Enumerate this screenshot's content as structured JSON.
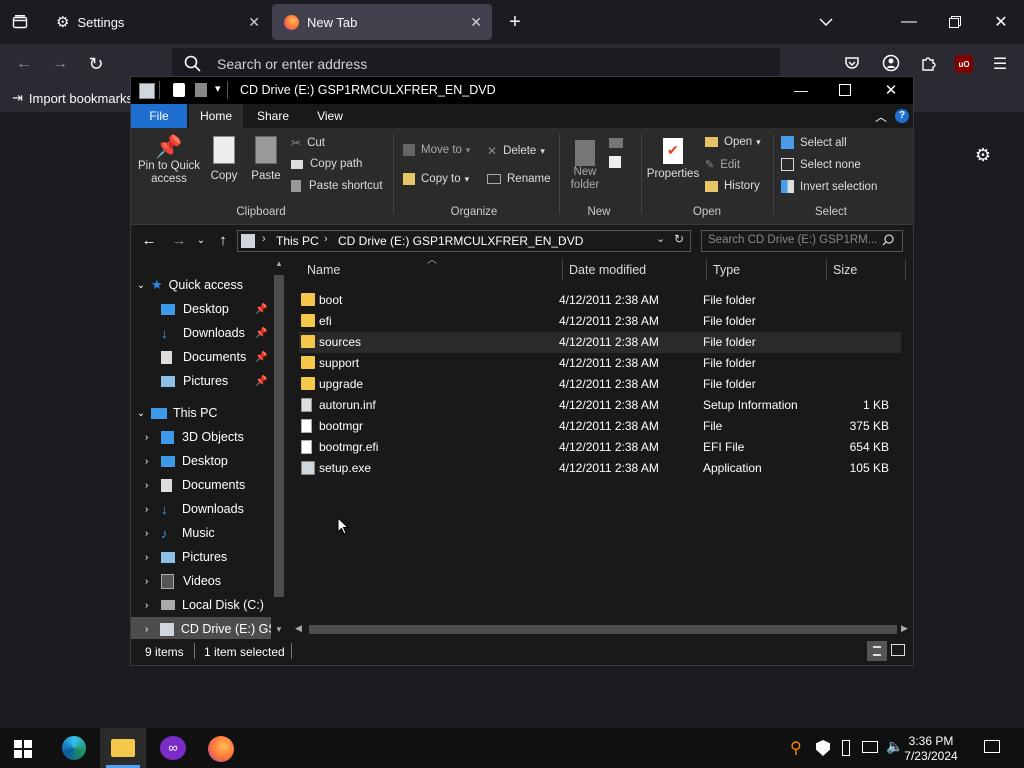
{
  "browser": {
    "tabs": [
      {
        "label": "Settings",
        "icon": "gear-icon"
      },
      {
        "label": "New Tab",
        "icon": "firefox-icon"
      }
    ],
    "address_placeholder": "Search or enter address",
    "bookmark": "Import bookmarks…"
  },
  "explorer": {
    "title": "CD Drive (E:) GSP1RMCULXFRER_EN_DVD",
    "ribbon_tabs": [
      "File",
      "Home",
      "Share",
      "View"
    ],
    "clipboard": {
      "pin": "Pin to Quick access",
      "copy": "Copy",
      "paste": "Paste",
      "cut": "Cut",
      "copy_path": "Copy path",
      "paste_shortcut": "Paste shortcut",
      "group": "Clipboard"
    },
    "organize": {
      "move_to": "Move to",
      "copy_to": "Copy to",
      "delete": "Delete",
      "rename": "Rename",
      "group": "Organize"
    },
    "new": {
      "new_folder": "New folder",
      "group": "New"
    },
    "open": {
      "properties": "Properties",
      "open": "Open",
      "edit": "Edit",
      "history": "History",
      "group": "Open"
    },
    "select": {
      "select_all": "Select all",
      "select_none": "Select none",
      "invert": "Invert selection",
      "group": "Select"
    },
    "address": {
      "this_pc": "This PC",
      "drive": "CD Drive (E:) GSP1RMCULXFRER_EN_DVD"
    },
    "search_placeholder": "Search CD Drive (E:) GSP1RM...",
    "nav": {
      "quick_access": "Quick access",
      "quick_items": [
        "Desktop",
        "Downloads",
        "Documents",
        "Pictures"
      ],
      "this_pc": "This PC",
      "pc_items": [
        "3D Objects",
        "Desktop",
        "Documents",
        "Downloads",
        "Music",
        "Pictures",
        "Videos",
        "Local Disk (C:)",
        "CD Drive (E:) GSP"
      ]
    },
    "columns": {
      "name": "Name",
      "date": "Date modified",
      "type": "Type",
      "size": "Size"
    },
    "files": [
      {
        "name": "boot",
        "date": "4/12/2011 2:38 AM",
        "type": "File folder",
        "size": "",
        "icon": "folder-icon"
      },
      {
        "name": "efi",
        "date": "4/12/2011 2:38 AM",
        "type": "File folder",
        "size": "",
        "icon": "folder-icon"
      },
      {
        "name": "sources",
        "date": "4/12/2011 2:38 AM",
        "type": "File folder",
        "size": "",
        "icon": "folder-icon"
      },
      {
        "name": "support",
        "date": "4/12/2011 2:38 AM",
        "type": "File folder",
        "size": "",
        "icon": "folder-icon"
      },
      {
        "name": "upgrade",
        "date": "4/12/2011 2:38 AM",
        "type": "File folder",
        "size": "",
        "icon": "folder-icon"
      },
      {
        "name": "autorun.inf",
        "date": "4/12/2011 2:38 AM",
        "type": "Setup Information",
        "size": "1 KB",
        "icon": "settings-file-icon"
      },
      {
        "name": "bootmgr",
        "date": "4/12/2011 2:38 AM",
        "type": "File",
        "size": "375 KB",
        "icon": "file-icon"
      },
      {
        "name": "bootmgr.efi",
        "date": "4/12/2011 2:38 AM",
        "type": "EFI File",
        "size": "654 KB",
        "icon": "file-icon"
      },
      {
        "name": "setup.exe",
        "date": "4/12/2011 2:38 AM",
        "type": "Application",
        "size": "105 KB",
        "icon": "setup-app-icon"
      }
    ],
    "status": {
      "items": "9 items",
      "selected": "1 item selected"
    }
  },
  "taskbar": {
    "time": "3:36 PM",
    "date": "7/23/2024"
  }
}
